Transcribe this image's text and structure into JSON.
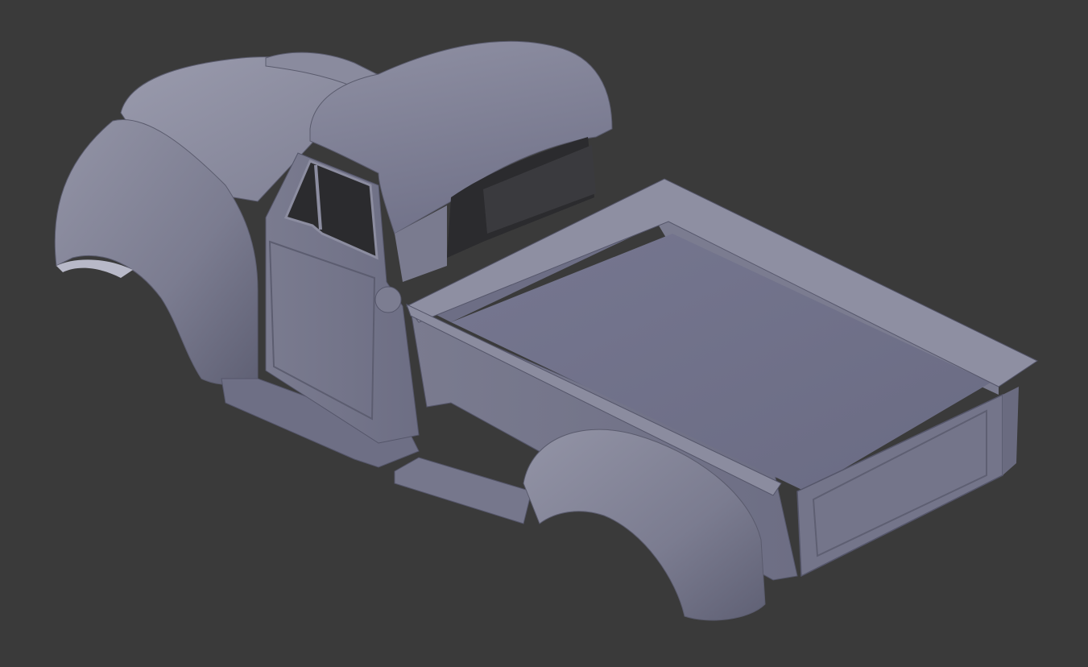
{
  "viewport": {
    "background_color": "#3a3a3a",
    "model_base_color": "#7e7f93",
    "model_highlight_color": "#a4a5b4",
    "model_shadow_color": "#4f5062",
    "window_color": "#2b2b2e"
  },
  "model": {
    "icon": "pickup-truck-3d-model"
  }
}
